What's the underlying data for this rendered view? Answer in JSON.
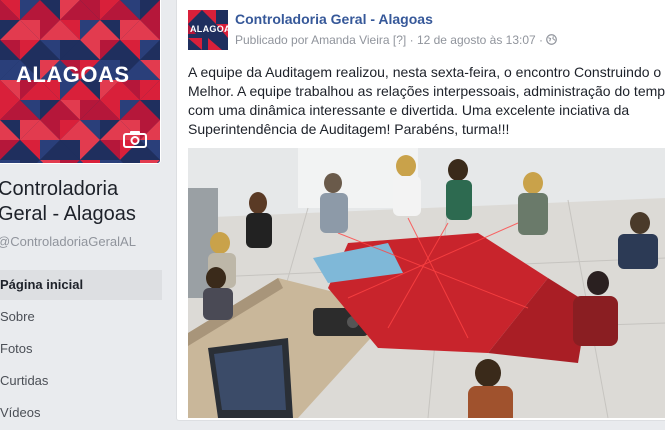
{
  "page": {
    "name": "Controladoria Geral - Alagoas",
    "handle": "@ControladoriaGeralAL",
    "logo_text": "ALAGOAS"
  },
  "nav": {
    "items": [
      {
        "label": "Página inicial",
        "active": true
      },
      {
        "label": "Sobre"
      },
      {
        "label": "Fotos"
      },
      {
        "label": "Curtidas"
      },
      {
        "label": "Vídeos"
      }
    ]
  },
  "post": {
    "author": "Controladoria Geral - Alagoas",
    "avatar_text": "ALAGOAS",
    "published_prefix": "Publicado por",
    "published_by": "Amanda Vieira",
    "help_marker": "[?]",
    "separator": "·",
    "date": "12 de agosto às 13:07",
    "text": "A equipe da Auditagem realizou, nesta sexta-feira, o encontro Construindo o Melhor. A equipe trabalhou as relações interpessoais, administração do tempo com uma dinâmica interessante e divertida. Uma excelente inciativa da Superintendência de Auditagem! Parabéns, turma!!!"
  },
  "colors": {
    "brand_blue": "#365899",
    "cover_red": "#d9203a",
    "cover_navy": "#1f2f5e"
  }
}
